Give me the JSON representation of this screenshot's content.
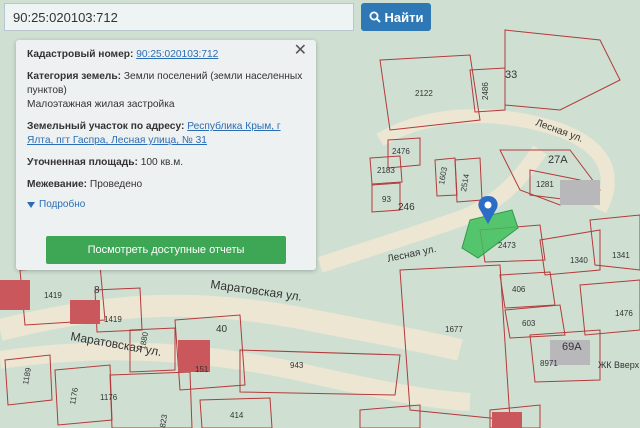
{
  "search": {
    "value": "90:25:020103:712",
    "button_label": "Найти"
  },
  "popup": {
    "cadastral_label": "Кадастровый номер:",
    "cadastral_value": "90:25:020103:712",
    "category_label": "Категория земель:",
    "category_value": "Земли поселений (земли населенных пунктов)",
    "category_use": "Малоэтажная жилая застройка",
    "address_label": "Земельный участок по адресу:",
    "address_value": "Республика Крым, г Ялта, пгт Гаспра, Лесная улица, № 31",
    "area_label": "Уточненная площадь:",
    "area_value": "100 кв.м.",
    "survey_label": "Межевание:",
    "survey_value": "Проведено",
    "more_label": "Подробно",
    "reports_button": "Посмотреть доступные отчеты"
  },
  "map": {
    "streets": [
      "Маратовская ул.",
      "Маратовская ул.",
      "Лесная ул.",
      "Лесная ул."
    ],
    "parcels": [
      "33",
      "2122",
      "2486",
      "2476",
      "2183",
      "93",
      "246",
      "1603",
      "2514",
      "27А",
      "1281",
      "1341",
      "1340",
      "2473",
      "406",
      "603",
      "1476",
      "1677",
      "69А",
      "8971",
      "1419",
      "1419",
      "8",
      "1880",
      "40",
      "151",
      "943",
      "1189",
      "1176",
      "1176",
      "414",
      "823"
    ],
    "poi": "ЖК Вверх Дель-Мар",
    "colors": {
      "parcel_border": "#b33a3a",
      "selected_parcel": "#3fbf5b",
      "marker": "#2b6cc4",
      "road": "#ece6d2"
    }
  }
}
